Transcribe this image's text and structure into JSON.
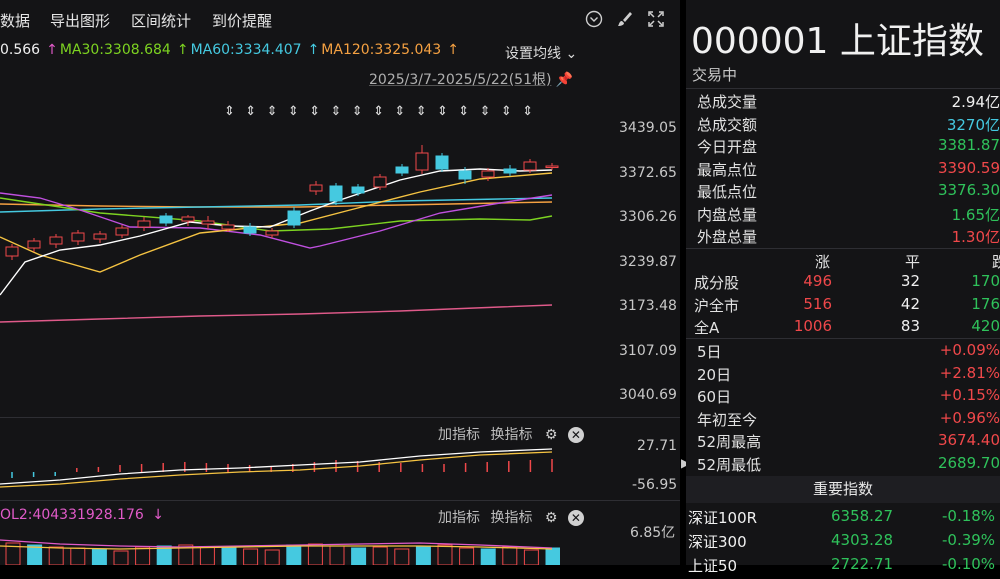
{
  "toolbar": {
    "items": [
      "数据",
      "导出图形",
      "区间统计",
      "到价提醒"
    ]
  },
  "ma": {
    "ma_first": "0.566",
    "ma30": "MA30:3308.684",
    "ma60": "MA60:3334.407",
    "ma120": "MA120:3325.043",
    "settings": "设置均线"
  },
  "range_label": "2025/3/7-2025/5/22(51根)",
  "y_axis": [
    "3439.05",
    "3372.65",
    "3306.26",
    "3239.87",
    "3173.48",
    "3107.09",
    "3040.69"
  ],
  "sub1": {
    "add": "加指标",
    "switch": "换指标",
    "top": "27.71",
    "bottom": "-56.95"
  },
  "sub2": {
    "ma_text": "OL2:404331928.176",
    "add": "加指标",
    "switch": "换指标",
    "top": "6.85亿"
  },
  "colors": {
    "up": "#f0484a",
    "down": "#45c9e0",
    "ma5": "#ffffff",
    "ma10": "#f5c342",
    "ma30": "#7dd321",
    "ma60": "#45c9e0",
    "ma120": "#f5a142",
    "ma250": "#e05a8a"
  },
  "quote": {
    "title": "000001 上证指数",
    "status": "交易中",
    "stats": [
      {
        "label": "总成交量",
        "value": "2.94亿",
        "color": "white"
      },
      {
        "label": "总成交额",
        "value": "3270亿",
        "color": "cyan"
      },
      {
        "label": "今日开盘",
        "value": "3381.87",
        "color": "green"
      },
      {
        "label": "最高点位",
        "value": "3390.59",
        "color": "red"
      },
      {
        "label": "最低点位",
        "value": "3376.30",
        "color": "green"
      },
      {
        "label": "内盘总量",
        "value": "1.65亿",
        "color": "green"
      },
      {
        "label": "外盘总量",
        "value": "1.30亿",
        "color": "red"
      }
    ],
    "breadth_header": {
      "up": "涨",
      "flat": "平",
      "down": "跌"
    },
    "breadth": [
      {
        "label": "成分股",
        "up": "496",
        "flat": "32",
        "down": "170"
      },
      {
        "label": "沪全市",
        "up": "516",
        "flat": "42",
        "down": "176"
      },
      {
        "label": "全A",
        "up": "1006",
        "flat": "83",
        "down": "420"
      }
    ],
    "periods": [
      {
        "label": "5日",
        "value": "+0.09%",
        "color": "red"
      },
      {
        "label": "20日",
        "value": "+2.81%",
        "color": "red"
      },
      {
        "label": "60日",
        "value": "+0.15%",
        "color": "red"
      },
      {
        "label": "年初至今",
        "value": "+0.96%",
        "color": "red"
      },
      {
        "label": "52周最高",
        "value": "3674.40",
        "color": "red"
      },
      {
        "label": "52周最低",
        "value": "2689.70",
        "color": "green"
      }
    ],
    "indices_header": "重要指数",
    "indices": [
      {
        "name": "深证100R",
        "value": "6358.27",
        "change": "-0.18%"
      },
      {
        "name": "深证300",
        "value": "4303.28",
        "change": "-0.39%"
      },
      {
        "name": "上证50",
        "value": "2722.71",
        "change": "-0.10%"
      }
    ]
  }
}
